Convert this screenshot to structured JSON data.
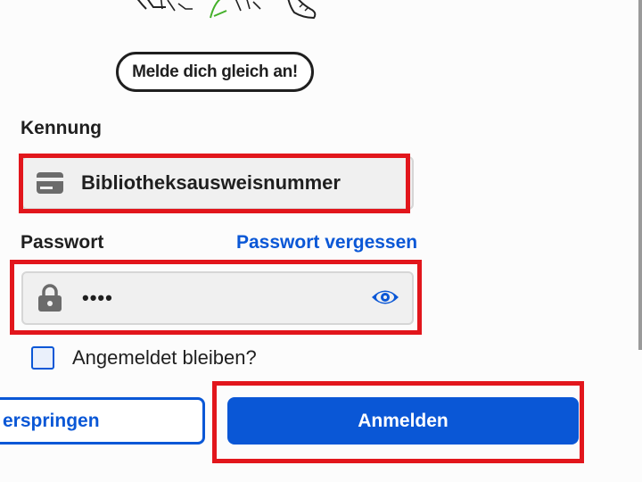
{
  "header": {
    "cta_pill": "Melde dich gleich an!"
  },
  "login": {
    "identifier_label": "Kennung",
    "identifier_placeholder": "Bibliotheksausweisnummer",
    "password_label": "Passwort",
    "forgot_password_link": "Passwort vergessen",
    "password_value": "••••",
    "remember_label": "Angemeldet bleiben?",
    "remember_checked": false,
    "skip_button_label": "erspringen",
    "login_button_label": "Anmelden"
  },
  "colors": {
    "accent": "#0a57d6",
    "highlight": "#e2161c",
    "field_bg": "#f0f0f0",
    "icon_gray": "#6b6b6b",
    "illustration_green": "#44b02a"
  },
  "icons": [
    "card-icon",
    "lock-icon",
    "eye-icon"
  ]
}
